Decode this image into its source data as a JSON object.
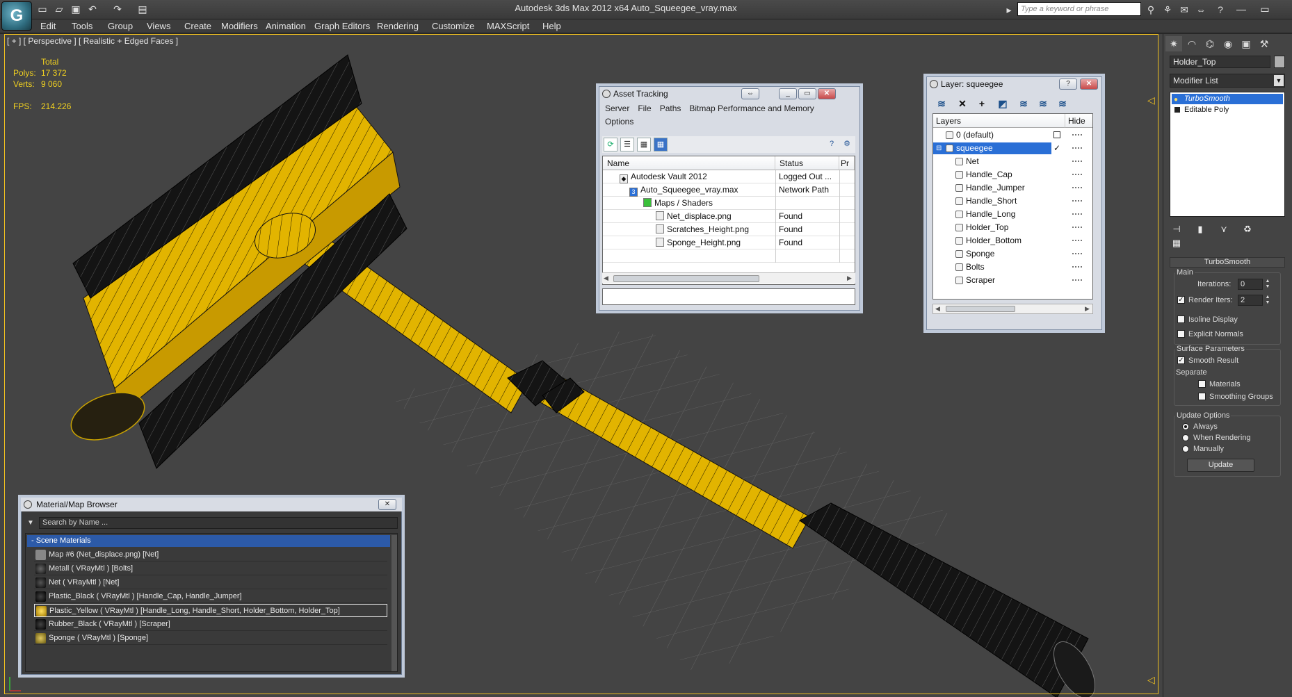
{
  "app": {
    "title": "Autodesk 3ds Max  2012 x64      Auto_Squeegee_vray.max",
    "search_placeholder": "Type a keyword or phrase"
  },
  "menu": [
    "Edit",
    "Tools",
    "Group",
    "Views",
    "Create",
    "Modifiers",
    "Animation",
    "Graph Editors",
    "Rendering",
    "Customize",
    "MAXScript",
    "Help"
  ],
  "viewport": {
    "label": "[ + ] [ Perspective ] [ Realistic + Edged Faces ]",
    "stats": {
      "total_label": "Total",
      "polys_label": "Polys:",
      "polys": "17 372",
      "verts_label": "Verts:",
      "verts": "9 060",
      "fps_label": "FPS:",
      "fps": "214.226"
    }
  },
  "command_panel": {
    "object_name": "Holder_Top",
    "modifier_list": "Modifier List",
    "stack": [
      "TurboSmooth",
      "Editable Poly"
    ],
    "turbosmooth": {
      "title": "TurboSmooth",
      "main_label": "Main",
      "iterations_label": "Iterations:",
      "iterations": "0",
      "render_iters_label": "Render Iters:",
      "render_iters": "2",
      "isoline_label": "Isoline Display",
      "explicit_normals_label": "Explicit Normals",
      "surface_params_label": "Surface Parameters",
      "smooth_result_label": "Smooth Result",
      "separate_label": "Separate",
      "materials_label": "Materials",
      "smoothing_groups_label": "Smoothing Groups",
      "update_options_label": "Update Options",
      "always_label": "Always",
      "when_rendering_label": "When Rendering",
      "manually_label": "Manually",
      "update_button": "Update"
    }
  },
  "asset_tracking": {
    "title": "Asset Tracking",
    "menu": [
      "Server",
      "File",
      "Paths",
      "Bitmap Performance and Memory"
    ],
    "menu2": "Options",
    "columns": [
      "Name",
      "Status",
      "Pr"
    ],
    "rows": [
      {
        "name": "Autodesk Vault 2012",
        "status": "Logged Out ...",
        "indent": 0
      },
      {
        "name": "Auto_Squeegee_vray.max",
        "status": "Network Path",
        "indent": 1
      },
      {
        "name": "Maps / Shaders",
        "status": "",
        "indent": 2
      },
      {
        "name": "Net_displace.png",
        "status": "Found",
        "indent": 3
      },
      {
        "name": "Scratches_Height.png",
        "status": "Found",
        "indent": 3
      },
      {
        "name": "Sponge_Height.png",
        "status": "Found",
        "indent": 3
      }
    ]
  },
  "layer_dialog": {
    "title": "Layer: squeegee",
    "columns": [
      "Layers",
      "Hide"
    ],
    "layers": [
      "0 (default)",
      "squeegee"
    ],
    "objects": [
      "Net",
      "Handle_Cap",
      "Handle_Jumper",
      "Handle_Short",
      "Handle_Long",
      "Holder_Top",
      "Holder_Bottom",
      "Sponge",
      "Bolts",
      "Scraper"
    ]
  },
  "material_browser": {
    "title": "Material/Map Browser",
    "search_placeholder": "Search by Name ...",
    "category": "- Scene Materials",
    "materials": [
      {
        "label": "Map #6 (Net_displace.png)  [Net]",
        "swatch": "#888888"
      },
      {
        "label": "Metall  ( VRayMtl )  [Bolts]",
        "swatch": "#222222"
      },
      {
        "label": "Net  ( VRayMtl )  [Net]",
        "swatch": "#1a1a1a"
      },
      {
        "label": "Plastic_Black  ( VRayMtl )  [Handle_Cap, Handle_Jumper]",
        "swatch": "#111111"
      },
      {
        "label": "Plastic_Yellow  ( VRayMtl )  [Handle_Long, Handle_Short, Holder_Bottom, Holder_Top]",
        "swatch": "#d4a800"
      },
      {
        "label": "Rubber_Black  ( VRayMtl )  [Scraper]",
        "swatch": "#151515"
      },
      {
        "label": "Sponge  ( VRayMtl )  [Sponge]",
        "swatch": "#b09a40"
      }
    ]
  },
  "colors": {
    "accent_selection": "#2a6fd6",
    "viewport_border": "#f0c020",
    "stats_text": "#f0d020",
    "model_yellow": "#e8b800",
    "model_black": "#111111"
  }
}
